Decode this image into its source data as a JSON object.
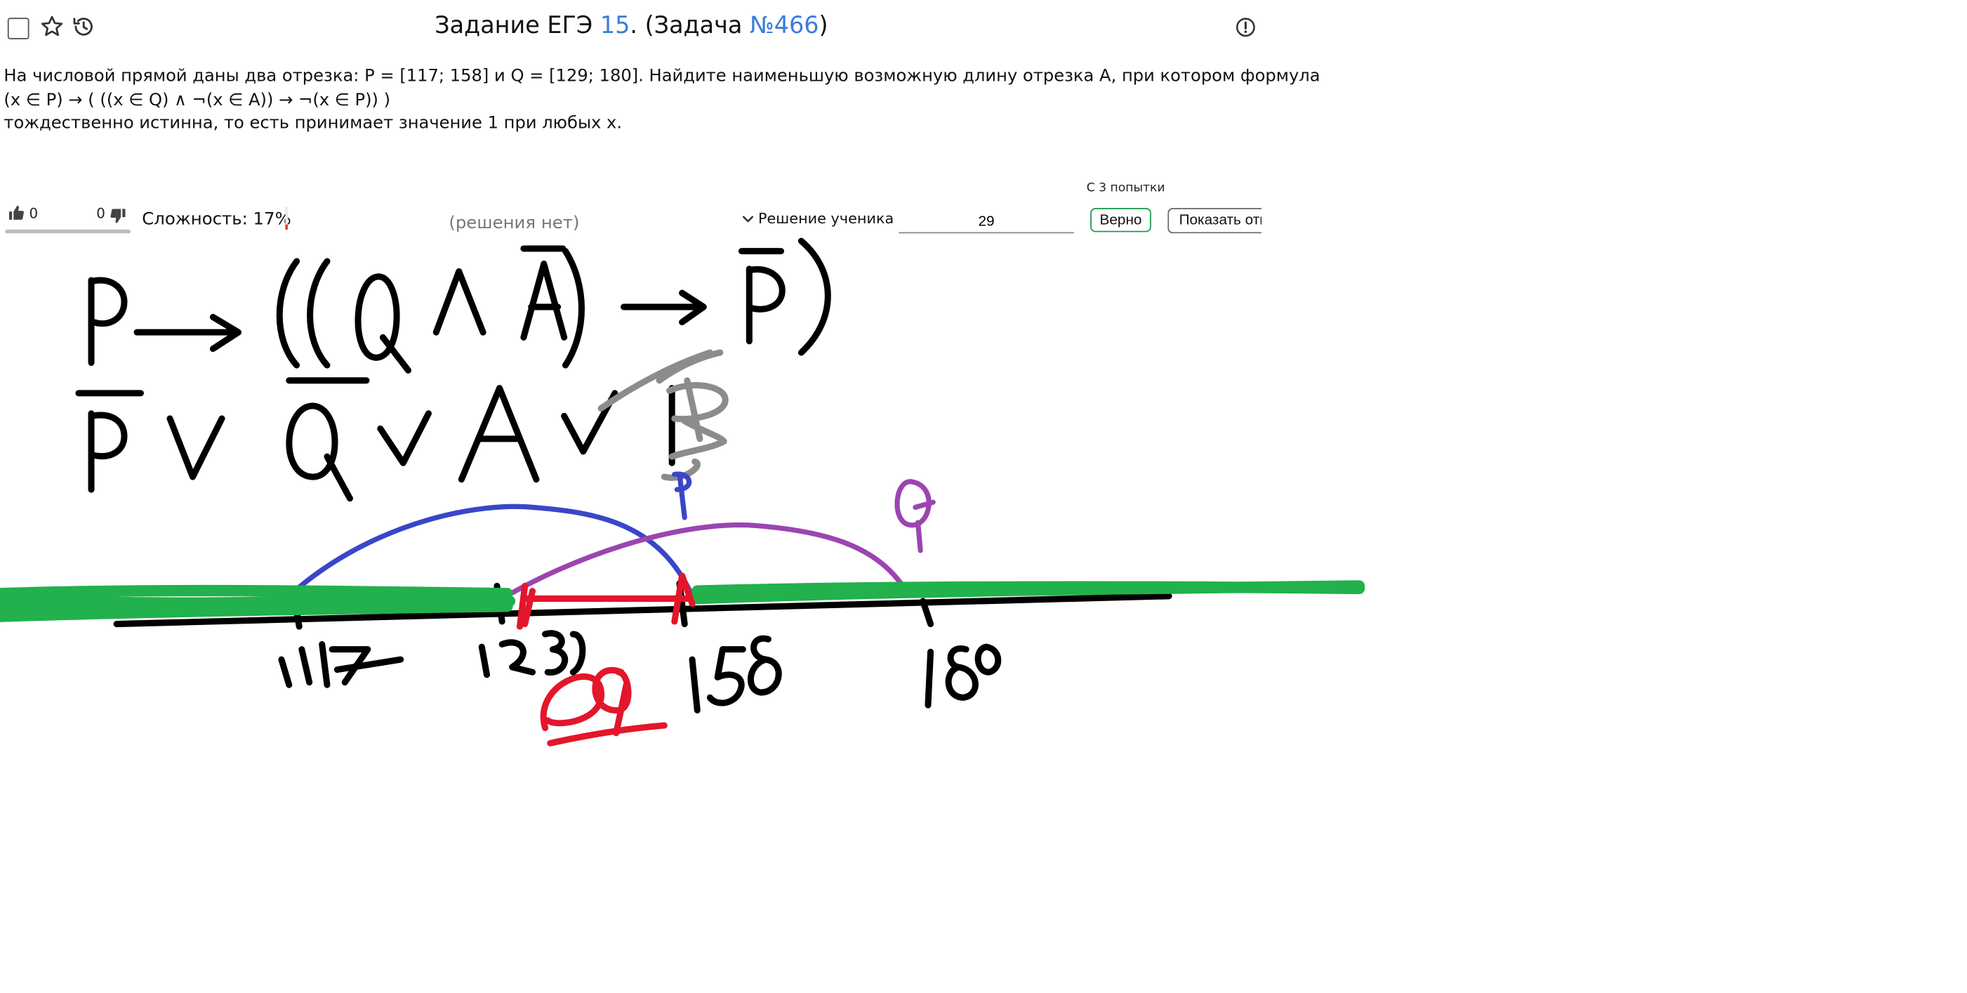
{
  "header": {
    "title_prefix": "Задание ЕГЭ ",
    "task_number": "15",
    "title_middle": ". (Задача ",
    "problem_id": "№466",
    "title_suffix": ")"
  },
  "problem": {
    "line1": "На числовой прямой даны два отрезка: P = [117; 158] и Q = [129; 180]. Найдите наименьшую возможную длину отрезка A, при котором формула",
    "line2": "(x ∈ P) → ( ((x ∈ Q) ∧ ¬(x ∈ A)) → ¬(x ∈ P)) )",
    "line3": "тождественно истинна, то есть принимает значение 1 при любых x."
  },
  "toolbar": {
    "likes": "0",
    "dislikes": "0",
    "difficulty": "Сложность: 17%",
    "difficulty_percent": 17,
    "no_solutions": "(решения нет)",
    "student_solution": "Решение ученика",
    "attempts": "С 3 попытки",
    "answer_value": "29",
    "correct_label": "Верно",
    "show_answer_label": "Показать ответ"
  },
  "colors": {
    "link": "#3b7ddd",
    "correct_border": "#1e9c51",
    "ink_black": "#000000",
    "ink_blue": "#3a46c8",
    "ink_purple": "#9b45b0",
    "ink_red": "#e3162b",
    "ink_green": "#22b14c",
    "ink_gray": "#8c8c8c"
  },
  "icons": [
    "checkbox-icon",
    "star-icon",
    "history-icon",
    "report-icon",
    "thumb-up-icon",
    "thumb-down-icon",
    "chevron-down-icon"
  ]
}
